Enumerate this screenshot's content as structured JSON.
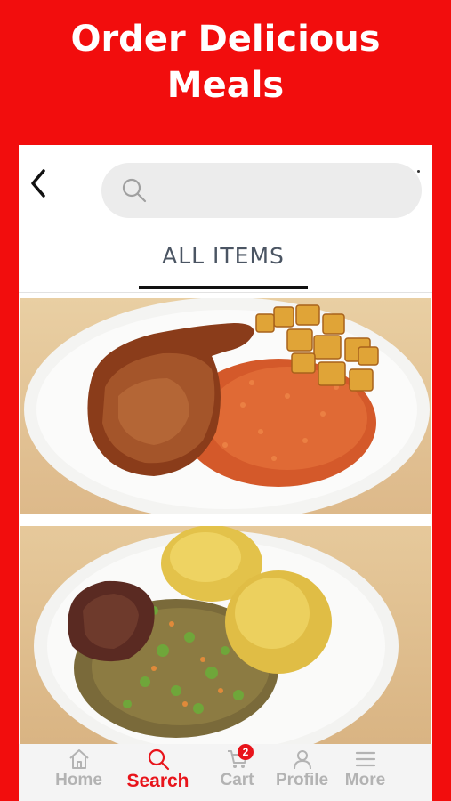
{
  "hero": {
    "title_line1": "Order Delicious",
    "title_line2": "Meals"
  },
  "header": {
    "search_placeholder": ""
  },
  "tabs": [
    {
      "label": "ALL ITEMS",
      "active": true
    }
  ],
  "menu_items": [
    {
      "image": "jollof-rice-chicken-plantain-photo"
    },
    {
      "image": "okra-soup-swallow-photo"
    }
  ],
  "bottom_nav": {
    "items": [
      {
        "label": "Home",
        "icon": "home-icon",
        "active": false
      },
      {
        "label": "Search",
        "icon": "search-icon",
        "active": true
      },
      {
        "label": "Cart",
        "icon": "cart-icon",
        "active": false,
        "badge": "2"
      },
      {
        "label": "Profile",
        "icon": "profile-icon",
        "active": false
      },
      {
        "label": "More",
        "icon": "menu-icon",
        "active": false
      }
    ]
  },
  "colors": {
    "brand_red": "#f20d0d",
    "active_red": "#e8141b",
    "inactive_gray": "#b3b3b3"
  }
}
